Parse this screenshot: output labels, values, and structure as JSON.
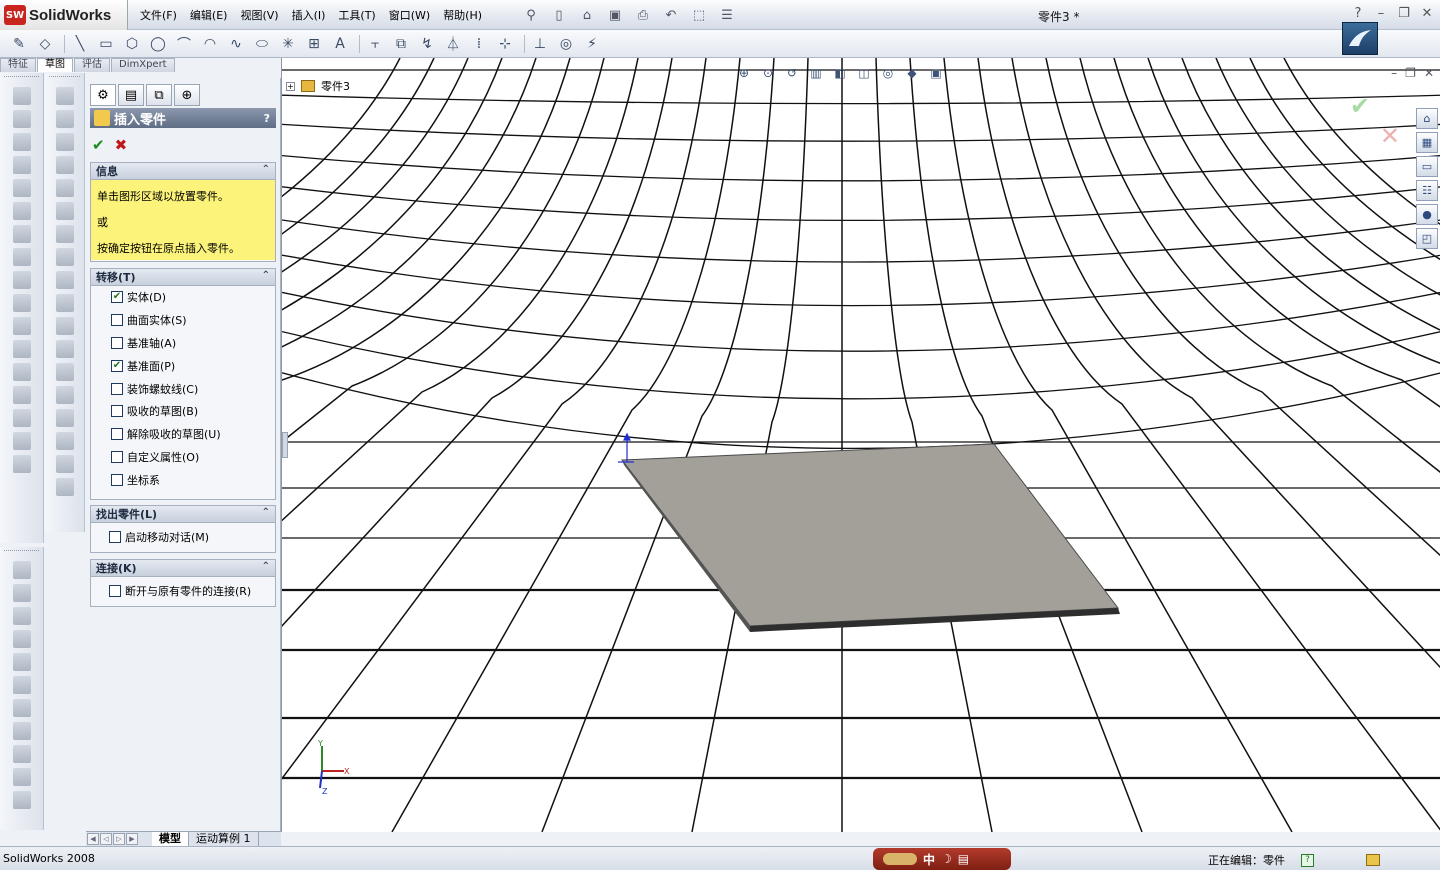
{
  "app": {
    "name": "SolidWorks",
    "badge": "SW",
    "document_title": "零件3 *",
    "version_text": "SolidWorks 2008"
  },
  "menu": [
    "文件(F)",
    "编辑(E)",
    "视图(V)",
    "插入(I)",
    "工具(T)",
    "窗口(W)",
    "帮助(H)"
  ],
  "command_tabs": [
    "特征",
    "草图",
    "评估",
    "DimXpert"
  ],
  "active_command_tab": "草图",
  "property_manager": {
    "title": "插入零件",
    "help": "?",
    "ok_symbol": "✔",
    "cancel_symbol": "✖",
    "info": {
      "heading": "信息",
      "lines": [
        "单击图形区域以放置零件。",
        "或",
        "按确定按钮在原点插入零件。"
      ]
    },
    "transfer": {
      "heading": "转移(T)",
      "items": [
        {
          "label": "实体(D)",
          "checked": true
        },
        {
          "label": "曲面实体(S)",
          "checked": false
        },
        {
          "label": "基准轴(A)",
          "checked": false
        },
        {
          "label": "基准面(P)",
          "checked": true
        },
        {
          "label": "装饰螺蚊线(C)",
          "checked": false
        },
        {
          "label": "吸收的草图(B)",
          "checked": false
        },
        {
          "label": "解除吸收的草图(U)",
          "checked": false
        },
        {
          "label": "自定义属性(O)",
          "checked": false
        },
        {
          "label": "坐标系",
          "checked": false
        }
      ]
    },
    "find_part": {
      "heading": "找出零件(L)",
      "items": [
        {
          "label": "启动移动对话(M)",
          "checked": false
        }
      ]
    },
    "link": {
      "heading": "连接(K)",
      "items": [
        {
          "label": "断开与原有零件的连接(R)",
          "checked": false
        }
      ]
    }
  },
  "bottom_tabs": [
    "模型",
    "运动算例 1"
  ],
  "active_bottom_tab": "模型",
  "viewport": {
    "tree_root": "零件3",
    "plate_color": "#a39f99",
    "grid_color": "#111111",
    "triad": {
      "x": "X",
      "y": "Y",
      "z": "Z"
    }
  },
  "status": {
    "editing": "正在编辑：零件",
    "ime_text": "中"
  },
  "colors": {
    "accent": "#5f6d85",
    "info_bg": "#fbf37a",
    "ok": "#1d8a1d",
    "cancel": "#c01818"
  }
}
